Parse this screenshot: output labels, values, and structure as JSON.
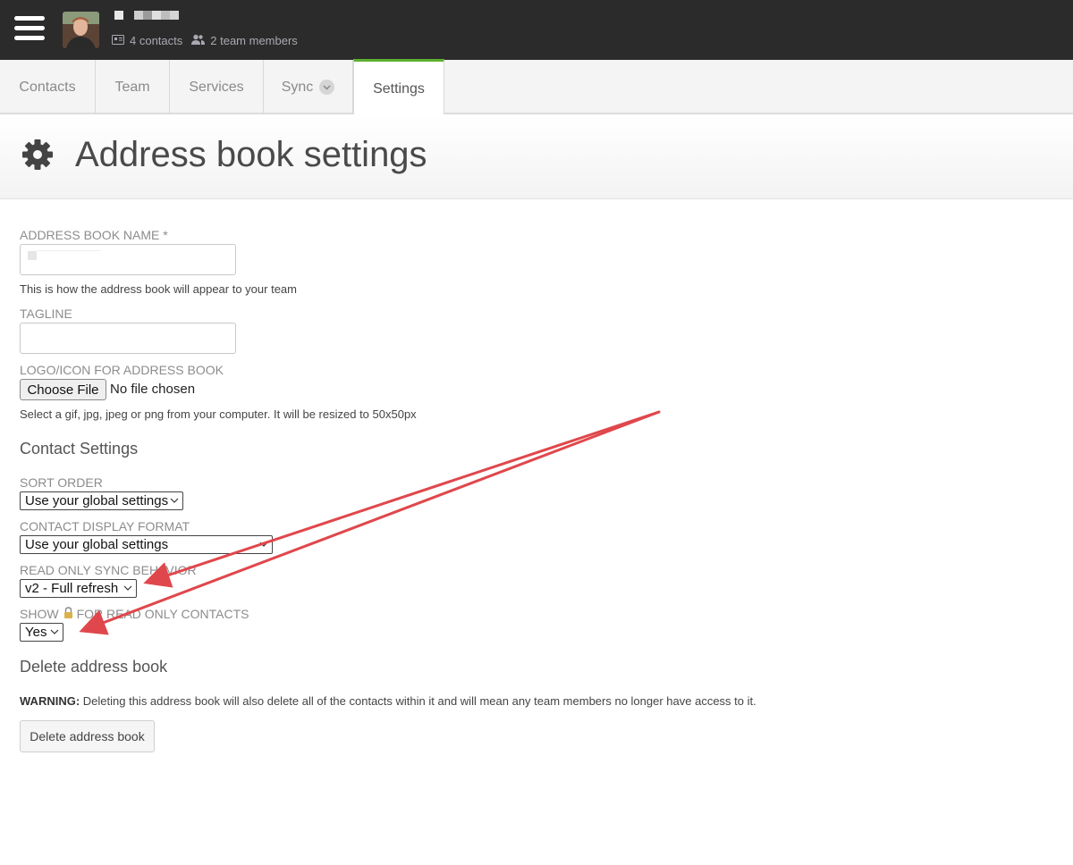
{
  "header": {
    "contacts_count": "4 contacts",
    "team_count": "2 team members"
  },
  "tabs": [
    {
      "label": "Contacts"
    },
    {
      "label": "Team"
    },
    {
      "label": "Services"
    },
    {
      "label": "Sync"
    },
    {
      "label": "Settings",
      "active": true
    }
  ],
  "page": {
    "title": "Address book settings"
  },
  "form": {
    "name_label": "ADDRESS BOOK NAME *",
    "name_help": "This is how the address book will appear to your team",
    "tagline_label": "TAGLINE",
    "logo_label": "LOGO/ICON FOR ADDRESS BOOK",
    "choose_file": "Choose File",
    "no_file": "No file chosen",
    "logo_help": "Select a gif, jpg, jpeg or png from your computer. It will be resized to 50x50px"
  },
  "contact_settings": {
    "title": "Contact Settings",
    "sort_label": "SORT ORDER",
    "sort_value": "Use your global settings",
    "display_label": "CONTACT DISPLAY FORMAT",
    "display_value": "Use your global settings",
    "sync_label": "READ ONLY SYNC BEHAVIOR",
    "sync_value": "v2 - Full refresh",
    "lock_label_pre": "SHOW",
    "lock_label_post": "FOR READ ONLY CONTACTS",
    "lock_value": "Yes"
  },
  "delete": {
    "title": "Delete address book",
    "warning_strong": "WARNING:",
    "warning_text": " Deleting this address book will also delete all of the contacts within it and will mean any team members no longer have access to it.",
    "button": "Delete address book"
  },
  "colors": {
    "topbar": "#2b2b2b",
    "accent": "#5cb02e",
    "arrow": "#e0474c"
  }
}
